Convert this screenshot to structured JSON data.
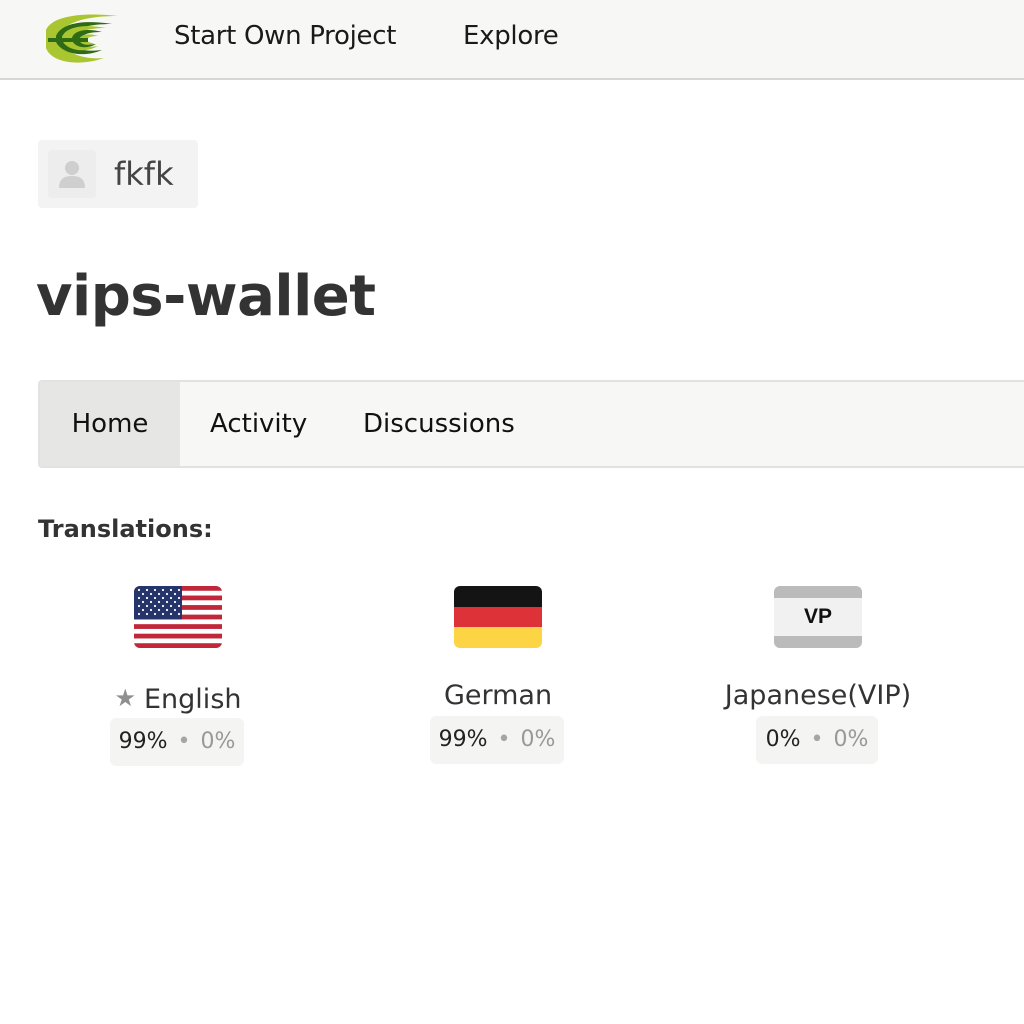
{
  "header": {
    "logo": "app-logo",
    "nav": [
      {
        "label": "Start Own Project"
      },
      {
        "label": "Explore"
      }
    ]
  },
  "owner": {
    "avatar": "user-avatar-placeholder",
    "name": "fkfk"
  },
  "project": {
    "title": "vips-wallet"
  },
  "tabs": [
    {
      "label": "Home",
      "active": true
    },
    {
      "label": "Activity",
      "active": false
    },
    {
      "label": "Discussions",
      "active": false
    }
  ],
  "translations": {
    "heading": "Translations:",
    "languages": [
      {
        "name": "English",
        "flag": "us-flag",
        "is_source": true,
        "translated": "99%",
        "separator": "•",
        "reviewed": "0%"
      },
      {
        "name": "German",
        "flag": "de-flag",
        "is_source": false,
        "translated": "99%",
        "separator": "•",
        "reviewed": "0%"
      },
      {
        "name": "Japanese(VIP)",
        "flag": "vp-flag",
        "flag_code": "VP",
        "is_source": false,
        "translated": "0%",
        "separator": "•",
        "reviewed": "0%"
      }
    ]
  },
  "colors": {
    "logo_green_light": "#a9c52f",
    "logo_green_dark": "#2f6b14",
    "header_bg": "#f7f7f5",
    "tab_active_bg": "#e6e6e4",
    "stats_bg": "#f4f4f2"
  }
}
